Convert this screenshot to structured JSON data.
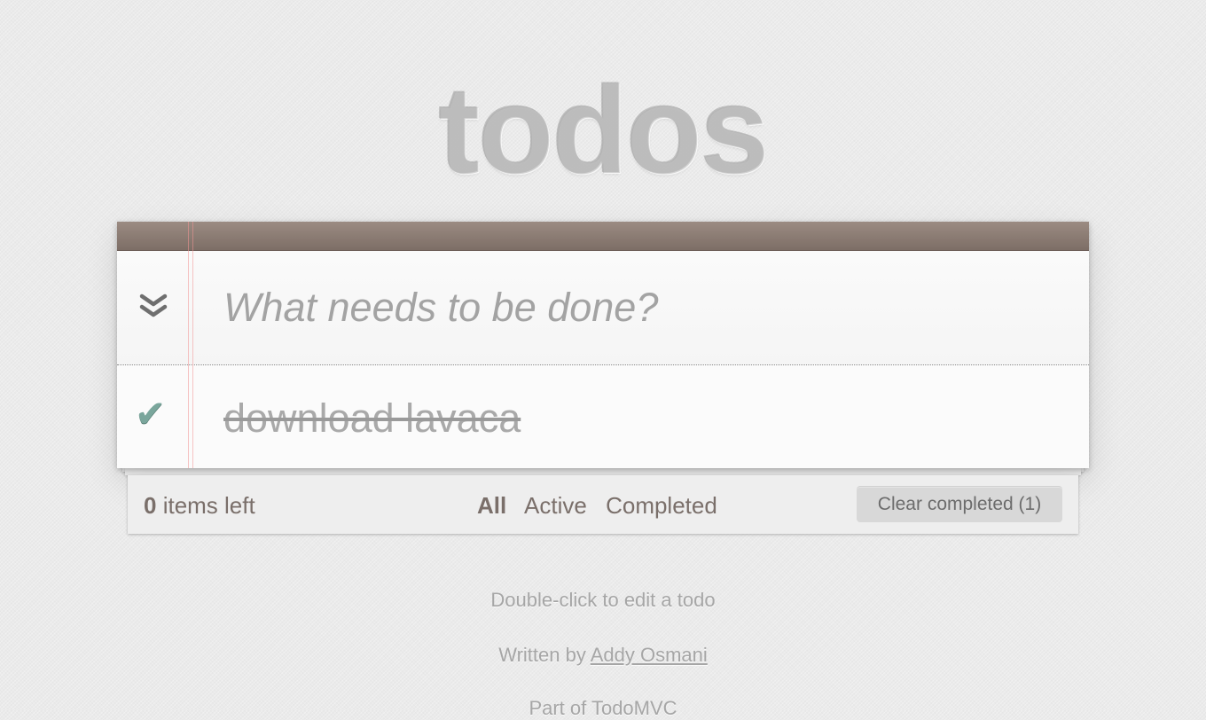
{
  "app": {
    "title": "todos"
  },
  "new_todo": {
    "placeholder": "What needs to be done?",
    "value": ""
  },
  "todos": [
    {
      "label": "download lavaca",
      "completed": true
    }
  ],
  "footer": {
    "count": "0",
    "count_suffix": " items left",
    "filters": [
      {
        "label": "All",
        "selected": true
      },
      {
        "label": "Active",
        "selected": false
      },
      {
        "label": "Completed",
        "selected": false
      }
    ],
    "clear_button": "Clear completed (1)"
  },
  "info": {
    "hint": "Double-click to edit a todo",
    "written_by_prefix": "Written by ",
    "author": "Addy Osmani",
    "part_of": "Part of TodoMVC"
  },
  "icons": {
    "toggle_all": "double-chevron-down-icon",
    "completed_check": "checkmark-icon"
  },
  "colors": {
    "header_bar": "#8c7c74",
    "check_mark": "#7aa69c",
    "margin_line": "#f29696",
    "page_background": "#eaeaea"
  }
}
